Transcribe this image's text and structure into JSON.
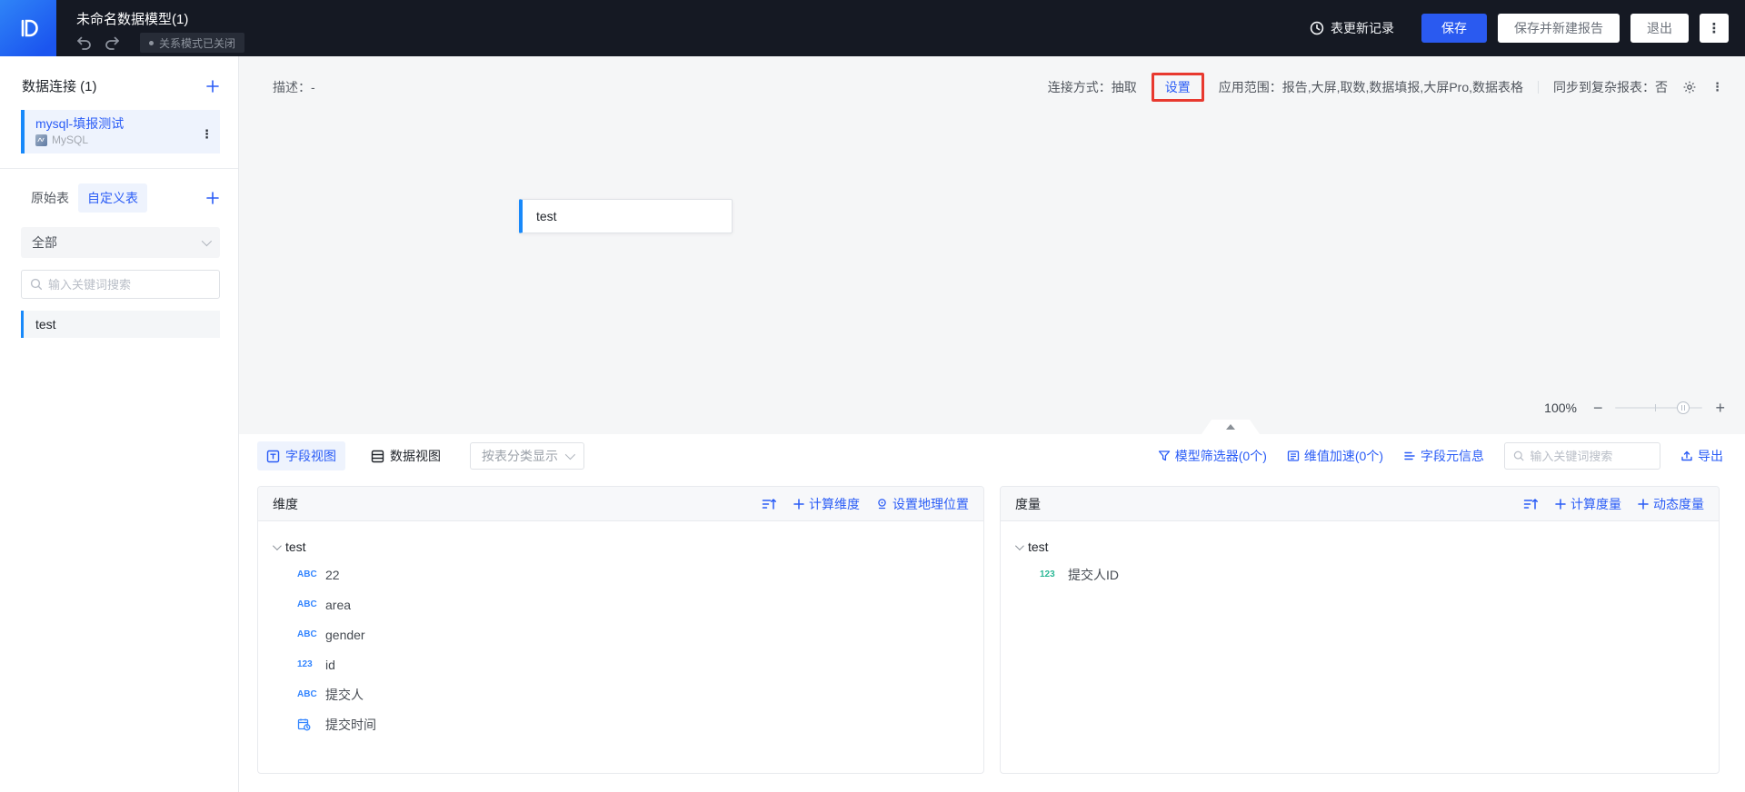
{
  "colors": {
    "accent_blue": "#2a5cf6",
    "selection_blue": "#1889fa",
    "field_icon_blue": "#3385ff",
    "measure_green": "#2cb896",
    "highlight_red": "#e8392f",
    "header_bg": "#151923"
  },
  "header": {
    "title": "未命名数据模型(1)",
    "relation_badge": "关系模式已关闭",
    "update_log": "表更新记录",
    "save": "保存",
    "save_new_report": "保存并新建报告",
    "exit": "退出"
  },
  "sidebar": {
    "connections_title": "数据连接 (1)",
    "connection": {
      "name": "mysql-填报测试",
      "type": "MySQL"
    },
    "tabs": {
      "original": "原始表",
      "custom": "自定义表"
    },
    "filter_selected": "全部",
    "search_placeholder": "输入关键词搜索",
    "table_item": "test"
  },
  "canvas": {
    "description": "描述：-",
    "connect_mode": "连接方式：抽取",
    "settings_link": "设置",
    "scope": "应用范围：报告,大屏,取数,数据填报,大屏Pro,数据表格",
    "sync": "同步到复杂报表：否",
    "node_title": "test",
    "zoom_level": "100%"
  },
  "bottom": {
    "tabs": {
      "field_view": "字段视图",
      "data_view": "数据视图"
    },
    "display_mode": "按表分类显示",
    "links": {
      "model_filter": "模型筛选器(0个)",
      "dim_accel": "维值加速(0个)",
      "field_meta": "字段元信息"
    },
    "search_placeholder": "输入关键词搜索",
    "export": "导出",
    "dimensions": {
      "title": "维度",
      "calc_action": "计算维度",
      "geo_action": "设置地理位置",
      "group": "test",
      "fields": [
        {
          "type": "text",
          "name": "22"
        },
        {
          "type": "text",
          "name": "area"
        },
        {
          "type": "text",
          "name": "gender"
        },
        {
          "type": "number",
          "name": "id"
        },
        {
          "type": "text",
          "name": "提交人"
        },
        {
          "type": "datetime",
          "name": "提交时间"
        }
      ]
    },
    "measures": {
      "title": "度量",
      "calc_action": "计算度量",
      "dynamic_action": "动态度量",
      "group": "test",
      "fields": [
        {
          "type": "number",
          "name": "提交人ID"
        }
      ]
    },
    "type_glyphs": {
      "text": "ABC",
      "number": "123"
    }
  }
}
